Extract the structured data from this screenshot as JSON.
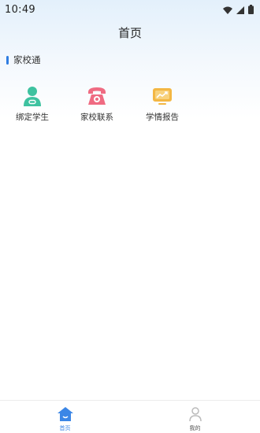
{
  "status_bar": {
    "time": "10:49",
    "icons": [
      "wifi-icon",
      "signal-icon",
      "battery-icon"
    ]
  },
  "header": {
    "title": "首页"
  },
  "section": {
    "title": "家校通",
    "accent": "#2f7de1"
  },
  "grid": {
    "items": [
      {
        "label": "绑定学生",
        "icon": "bind-student-icon",
        "color": "#3ec2a0"
      },
      {
        "label": "家校联系",
        "icon": "telephone-icon",
        "color": "#ef6b82"
      },
      {
        "label": "学情报告",
        "icon": "report-icon",
        "color": "#f3b744"
      }
    ]
  },
  "tabbar": {
    "tabs": [
      {
        "label": "首页",
        "icon": "home-icon",
        "active": true
      },
      {
        "label": "我的",
        "icon": "profile-icon",
        "active": false
      }
    ],
    "active_color": "#3b86e6"
  }
}
